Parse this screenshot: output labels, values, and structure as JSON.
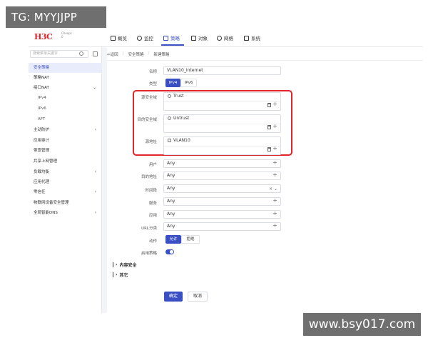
{
  "watermarks": {
    "top_left": "TG: MYYJJPP",
    "bottom_right": "www.bsy017.com"
  },
  "header": {
    "logo": "H3C",
    "logo_sub_1": "Cheops",
    "logo_sub_2": "0",
    "nav": [
      {
        "label": "概览",
        "icon": "dashboard-icon"
      },
      {
        "label": "监控",
        "icon": "monitor-icon"
      },
      {
        "label": "策略",
        "icon": "policy-icon",
        "active": true
      },
      {
        "label": "对象",
        "icon": "object-icon"
      },
      {
        "label": "网络",
        "icon": "network-icon"
      },
      {
        "label": "系统",
        "icon": "system-icon"
      }
    ]
  },
  "sidebar": {
    "search_placeholder": "搜索菜单关键字",
    "items": [
      {
        "label": "安全策略",
        "active": true
      },
      {
        "label": "策略NAT"
      },
      {
        "label": "接口NAT",
        "expanded": true
      },
      {
        "label": "IPv4",
        "sub": true
      },
      {
        "label": "IPv6",
        "sub": true
      },
      {
        "label": "AFT",
        "sub": true
      },
      {
        "label": "主动防护",
        "has_arrow": true
      },
      {
        "label": "应用审计"
      },
      {
        "label": "带宽管理"
      },
      {
        "label": "共享上网管理"
      },
      {
        "label": "负载均衡",
        "has_arrow": true
      },
      {
        "label": "应用代理"
      },
      {
        "label": "零信任",
        "has_arrow": true
      },
      {
        "label": "物联网设备安全管理"
      },
      {
        "label": "全局智能DNS",
        "has_arrow": true
      }
    ]
  },
  "breadcrumb": {
    "back": "返回",
    "parent": "安全策略",
    "current": "新建策略"
  },
  "form": {
    "name_label": "名称",
    "name_value": "VLAN10_Internet",
    "type_label": "类型",
    "type_options": [
      "IPv4",
      "IPv6"
    ],
    "src_zone_label": "源安全域",
    "src_zone_value": "Trust",
    "dst_zone_label": "目的安全域",
    "dst_zone_value": "Untrust",
    "src_addr_label": "源地址",
    "src_addr_value": "VLAN10",
    "user_label": "用户",
    "user_value": "Any",
    "dst_addr_label": "目的地址",
    "dst_addr_value": "Any",
    "time_label": "时间段",
    "time_value": "Any",
    "service_label": "服务",
    "service_value": "Any",
    "app_label": "应用",
    "app_value": "Any",
    "url_label": "URL分类",
    "url_value": "Any",
    "action_label": "动作",
    "action_options": [
      "允许",
      "拒绝"
    ],
    "enable_label": "启用策略",
    "section_content_security": "内容安全",
    "section_other": "其它",
    "ok_button": "确定",
    "cancel_button": "取消"
  }
}
